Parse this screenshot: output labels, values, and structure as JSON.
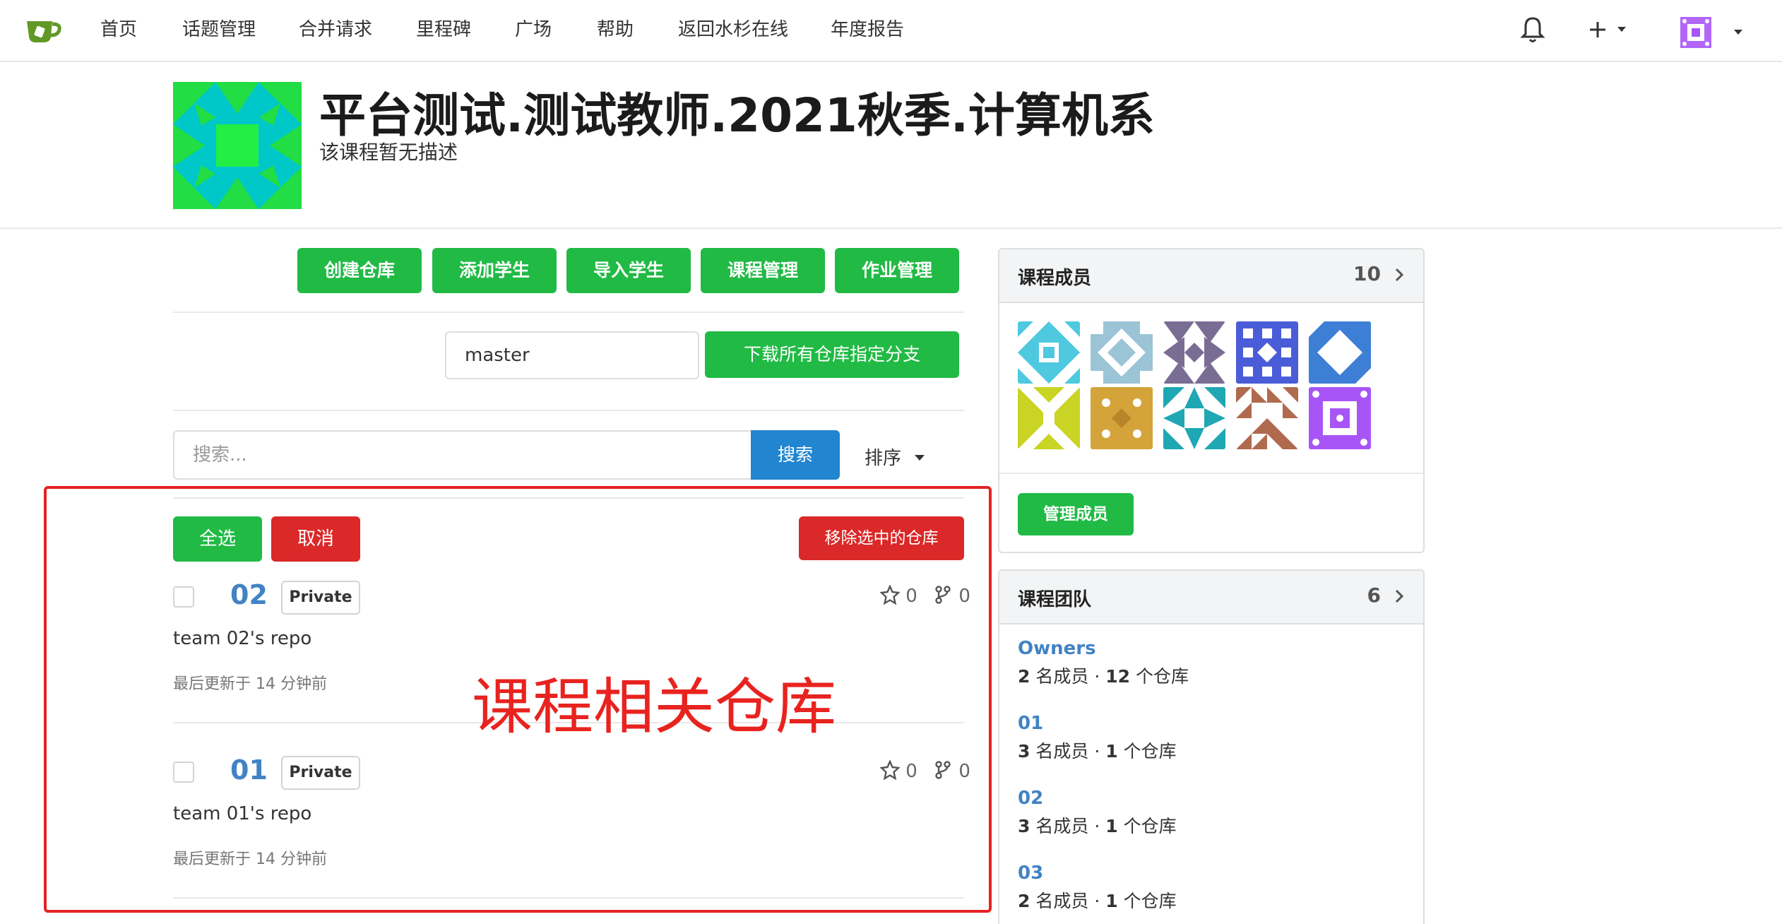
{
  "nav": {
    "items": [
      "首页",
      "话题管理",
      "合并请求",
      "里程碑",
      "广场",
      "帮助",
      "返回水杉在线",
      "年度报告"
    ]
  },
  "header": {
    "title": "平台测试.测试教师.2021秋季.计算机系",
    "description": "该课程暂无描述"
  },
  "actions": {
    "create_repo": "创建仓库",
    "add_students": "添加学生",
    "import_students": "导入学生",
    "course_manage": "课程管理",
    "homework_manage": "作业管理"
  },
  "branch": {
    "value": "master",
    "download_label": "下载所有仓库指定分支"
  },
  "search": {
    "placeholder": "搜索...",
    "button": "搜索",
    "sort": "排序"
  },
  "bulk": {
    "select_all": "全选",
    "cancel": "取消",
    "remove_selected": "移除选中的仓库"
  },
  "repos": [
    {
      "name": "02",
      "visibility": "Private",
      "description": "team 02's repo",
      "updated": "最后更新于 14 分钟前",
      "stars": "0",
      "forks": "0"
    },
    {
      "name": "01",
      "visibility": "Private",
      "description": "team 01's repo",
      "updated": "最后更新于 14 分钟前",
      "stars": "0",
      "forks": "0"
    }
  ],
  "caption": "课程相关仓库",
  "members_panel": {
    "title": "课程成员",
    "count": "10",
    "manage_button": "管理成员"
  },
  "teams_panel": {
    "title": "课程团队",
    "count": "6",
    "teams": [
      {
        "name": "Owners",
        "members": "2",
        "members_label": "名成员",
        "repos": "12",
        "repos_label": "个仓库"
      },
      {
        "name": "01",
        "members": "3",
        "members_label": "名成员",
        "repos": "1",
        "repos_label": "个仓库"
      },
      {
        "name": "02",
        "members": "3",
        "members_label": "名成员",
        "repos": "1",
        "repos_label": "个仓库"
      },
      {
        "name": "03",
        "members": "2",
        "members_label": "名成员",
        "repos": "1",
        "repos_label": "个仓库"
      }
    ]
  },
  "colors": {
    "green": "#21ba45",
    "red": "#db2828",
    "blue": "#2185d0",
    "link": "#4183c4",
    "annotation_red": "#e8231f"
  },
  "icons": [
    "gitea-logo-icon",
    "bell-icon",
    "plus-icon",
    "caret-down-icon",
    "star-icon",
    "fork-icon",
    "chevron-right-icon"
  ]
}
